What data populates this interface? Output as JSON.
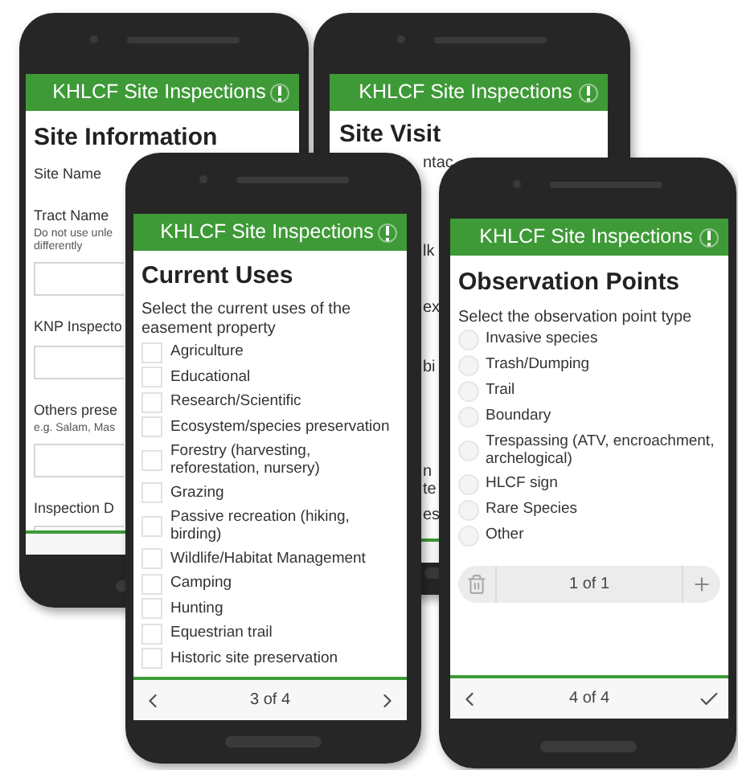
{
  "phones": [
    {
      "kind": "form",
      "header": {
        "title": "KHLCF Site Inspections"
      },
      "page_title": "Site Information",
      "items": [
        {
          "kind": "label",
          "text": "Site Name"
        },
        {
          "kind": "label",
          "text": "Tract Name"
        },
        {
          "kind": "hint",
          "text": "Do not use unle"
        },
        {
          "kind": "hint",
          "text": "differently"
        },
        {
          "kind": "input"
        },
        {
          "kind": "label",
          "text": "KNP Inspecto"
        },
        {
          "kind": "input"
        },
        {
          "kind": "label",
          "text": "Others prese"
        },
        {
          "kind": "hint",
          "text": "e.g. Salam, Mas"
        },
        {
          "kind": "input"
        },
        {
          "kind": "label",
          "text": "Inspection D"
        },
        {
          "kind": "date_input"
        }
      ]
    },
    {
      "kind": "fragments",
      "header": {
        "title": "KHLCF Site Inspections"
      },
      "page_title": "Site Visit",
      "fragments": [
        "ntac",
        "lk",
        "ex",
        "bi",
        "n",
        "te",
        "es"
      ]
    },
    {
      "kind": "checklist",
      "header": {
        "title": "KHLCF Site Inspections"
      },
      "page_title": "Current Uses",
      "prompt": "Select the current uses of the easement property",
      "options": [
        {
          "label": "Agriculture",
          "checked": false
        },
        {
          "label": "Educational",
          "checked": false
        },
        {
          "label": "Research/Scientific",
          "checked": false
        },
        {
          "label": "Ecosystem/species preservation",
          "checked": false
        },
        {
          "label": "Forestry (harvesting, reforestation, nursery)",
          "checked": false
        },
        {
          "label": "Grazing",
          "checked": false
        },
        {
          "label": "Passive recreation (hiking, birding)",
          "checked": false
        },
        {
          "label": "Wildlife/Habitat Management",
          "checked": false
        },
        {
          "label": "Camping",
          "checked": false
        },
        {
          "label": "Hunting",
          "checked": false
        },
        {
          "label": "Equestrian trail",
          "checked": false
        },
        {
          "label": "Historic site preservation",
          "checked": false
        }
      ],
      "footer": {
        "page": "3 of 4",
        "kind": "next"
      }
    },
    {
      "kind": "radiolist",
      "header": {
        "title": "KHLCF Site Inspections"
      },
      "page_title": "Observation Points",
      "prompt": "Select the observation point type",
      "options": [
        {
          "label": "Invasive species",
          "selected": false
        },
        {
          "label": "Trash/Dumping",
          "selected": false
        },
        {
          "label": "Trail",
          "selected": false
        },
        {
          "label": "Boundary",
          "selected": false
        },
        {
          "label": "Trespassing (ATV, encroachment, archelogical)",
          "selected": false
        },
        {
          "label": "HLCF sign",
          "selected": false
        },
        {
          "label": "Rare Species",
          "selected": false
        },
        {
          "label": "Other",
          "selected": false
        }
      ],
      "repeat": {
        "page": "1 of 1"
      },
      "footer": {
        "page": "4 of 4",
        "kind": "submit"
      }
    }
  ]
}
